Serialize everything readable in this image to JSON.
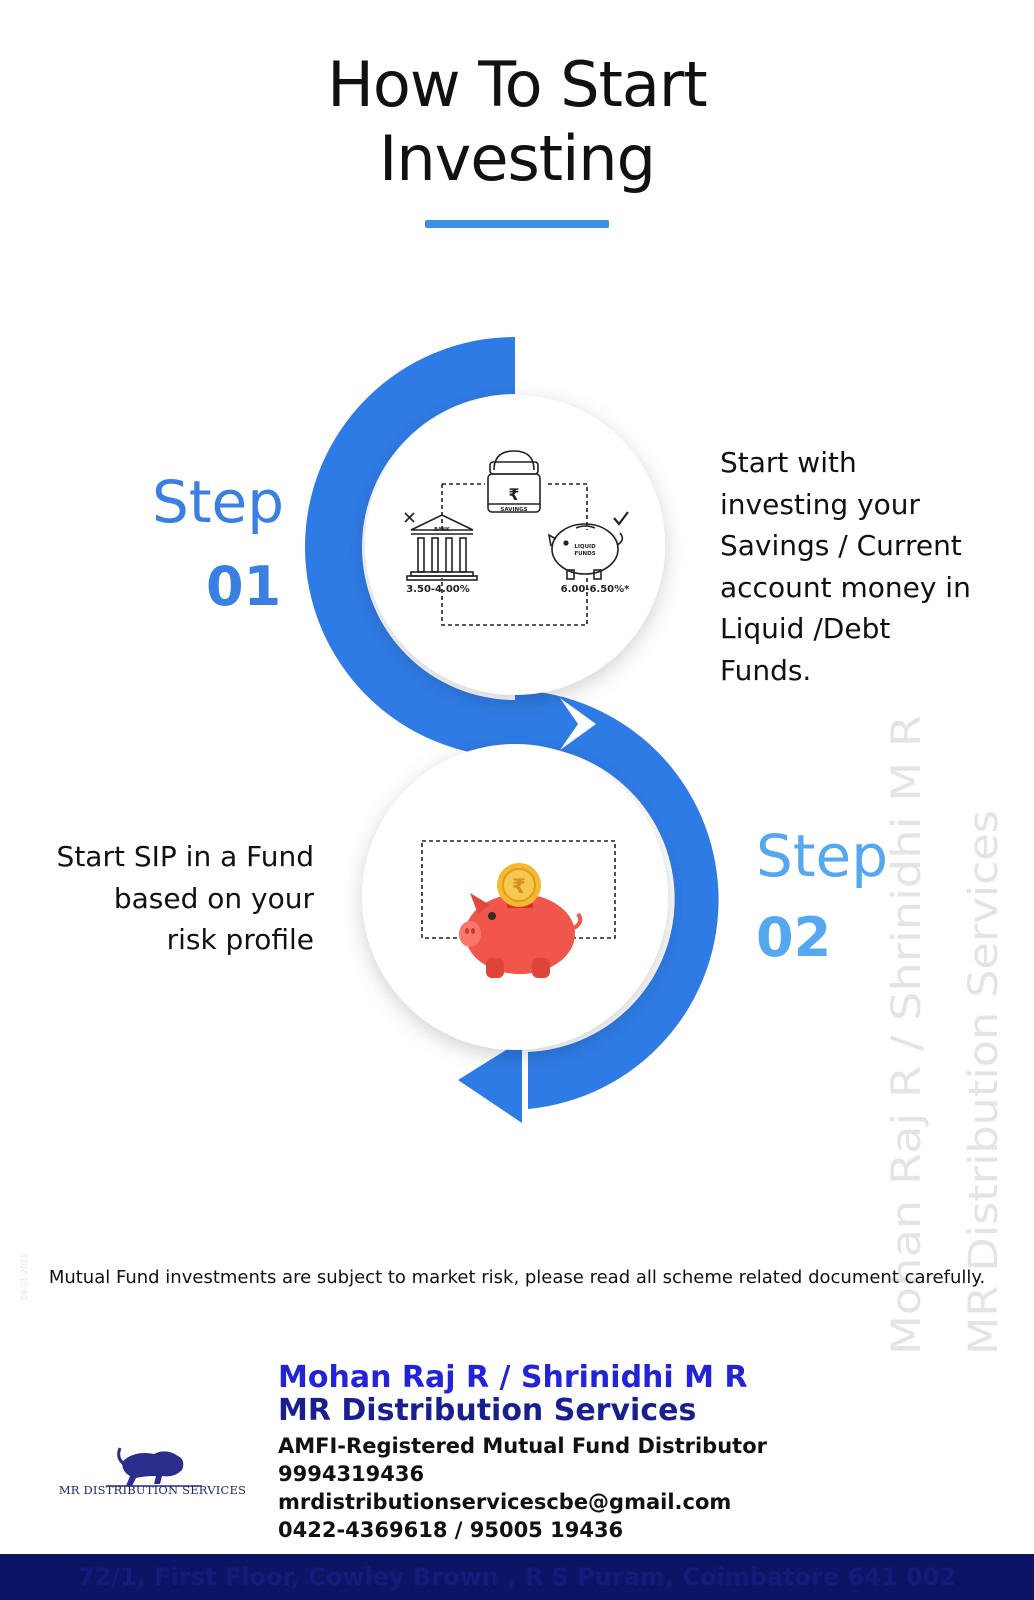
{
  "header": {
    "title_line1": "How To Start",
    "title_line2": "Investing"
  },
  "step1": {
    "word": "Step",
    "number": "01",
    "description_lines": [
      "Start with",
      "investing your",
      "Savings / Current",
      "account money in",
      "Liquid /Debt",
      "Funds."
    ],
    "icons": {
      "savings_label": "SAVINGS",
      "bank_label": "BANK",
      "bank_rate": "3.50-4.00%",
      "liquid_label_1": "LIQUID",
      "liquid_label_2": "FUNDS",
      "liquid_rate": "6.00-6.50%*",
      "rupee_symbol": "₹"
    }
  },
  "step2": {
    "word": "Step",
    "number": "02",
    "description_lines": [
      "Start SIP in a Fund",
      "based on your",
      "risk profile"
    ],
    "coin_symbol": "₹"
  },
  "watermark": {
    "line1": "Mohan Raj R / Shrinidhi M R",
    "line2": "MR Distribution Services"
  },
  "disclaimer": "Mutual Fund investments are subject to market risk, please read all scheme related document carefully.",
  "date_stamp": "09-01-2021",
  "logo": {
    "text": "MR  DISTRIBUTION SERVICES",
    "icon": "bull-icon"
  },
  "contact": {
    "names": "Mohan Raj R / Shrinidhi M R",
    "company": "MR Distribution Services",
    "designation": "AMFI-Registered Mutual Fund Distributor",
    "phone": "9994319436",
    "email": "mrdistributionservicescbe@gmail.com",
    "landline": "0422-4369618 / 95005 19436"
  },
  "footer": {
    "address": "72/1, First Floor, Cowley Brown , R S Puram, Coimbatore 641 002"
  },
  "colors": {
    "accent_blue": "#2f7be5",
    "step2_blue": "#55a7ef",
    "name_blue": "#2323d8",
    "company_navy": "#1a1f8f",
    "footer_navy": "#0c1466",
    "piggy_red": "#f0564a",
    "coin_gold": "#f5b82e"
  }
}
